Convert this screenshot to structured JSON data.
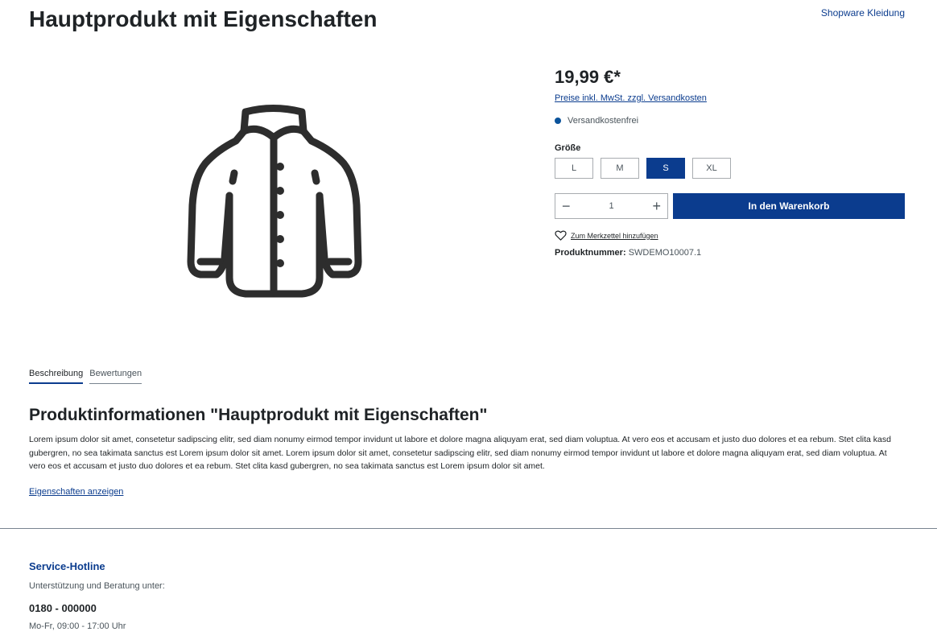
{
  "product": {
    "title": "Hauptprodukt mit Eigenschaften",
    "manufacturer": "Shopware Kleidung",
    "image_icon": "jacket-icon"
  },
  "buybox": {
    "price": "19,99 €*",
    "tax_note": "Preise inkl. MwSt. zzgl. Versandkosten",
    "shipping": "Versandkostenfrei",
    "size_label": "Größe",
    "sizes": [
      "L",
      "M",
      "S",
      "XL"
    ],
    "selected_size": "S",
    "quantity": "1",
    "cart_button": "In den Warenkorb",
    "wishlist": "Zum Merkzettel hinzufügen",
    "product_number_label": "Produktnummer:",
    "product_number": "SWDEMO10007.1"
  },
  "tabs": [
    "Beschreibung",
    "Bewertungen"
  ],
  "info": {
    "heading": "Produktinformationen \"Hauptprodukt mit Eigenschaften\"",
    "text": "Lorem ipsum dolor sit amet, consetetur sadipscing elitr, sed diam nonumy eirmod tempor invidunt ut labore et dolore magna aliquyam erat, sed diam voluptua. At vero eos et accusam et justo duo dolores et ea rebum. Stet clita kasd gubergren, no sea takimata sanctus est Lorem ipsum dolor sit amet. Lorem ipsum dolor sit amet, consetetur sadipscing elitr, sed diam nonumy eirmod tempor invidunt ut labore et dolore magna aliquyam erat, sed diam voluptua. At vero eos et accusam et justo duo dolores et ea rebum. Stet clita kasd gubergren, no sea takimata sanctus est Lorem ipsum dolor sit amet.",
    "props_link": "Eigenschaften anzeigen"
  },
  "footer": {
    "hotline_title": "Service-Hotline",
    "support": "Unterstützung und Beratung unter:",
    "phone": "0180 - 000000",
    "hours": "Mo-Fr, 09:00 - 17:00 Uhr"
  },
  "colors": {
    "primary": "#0b3c8e",
    "status_dot": "#0b539b",
    "text": "#1f2326"
  }
}
